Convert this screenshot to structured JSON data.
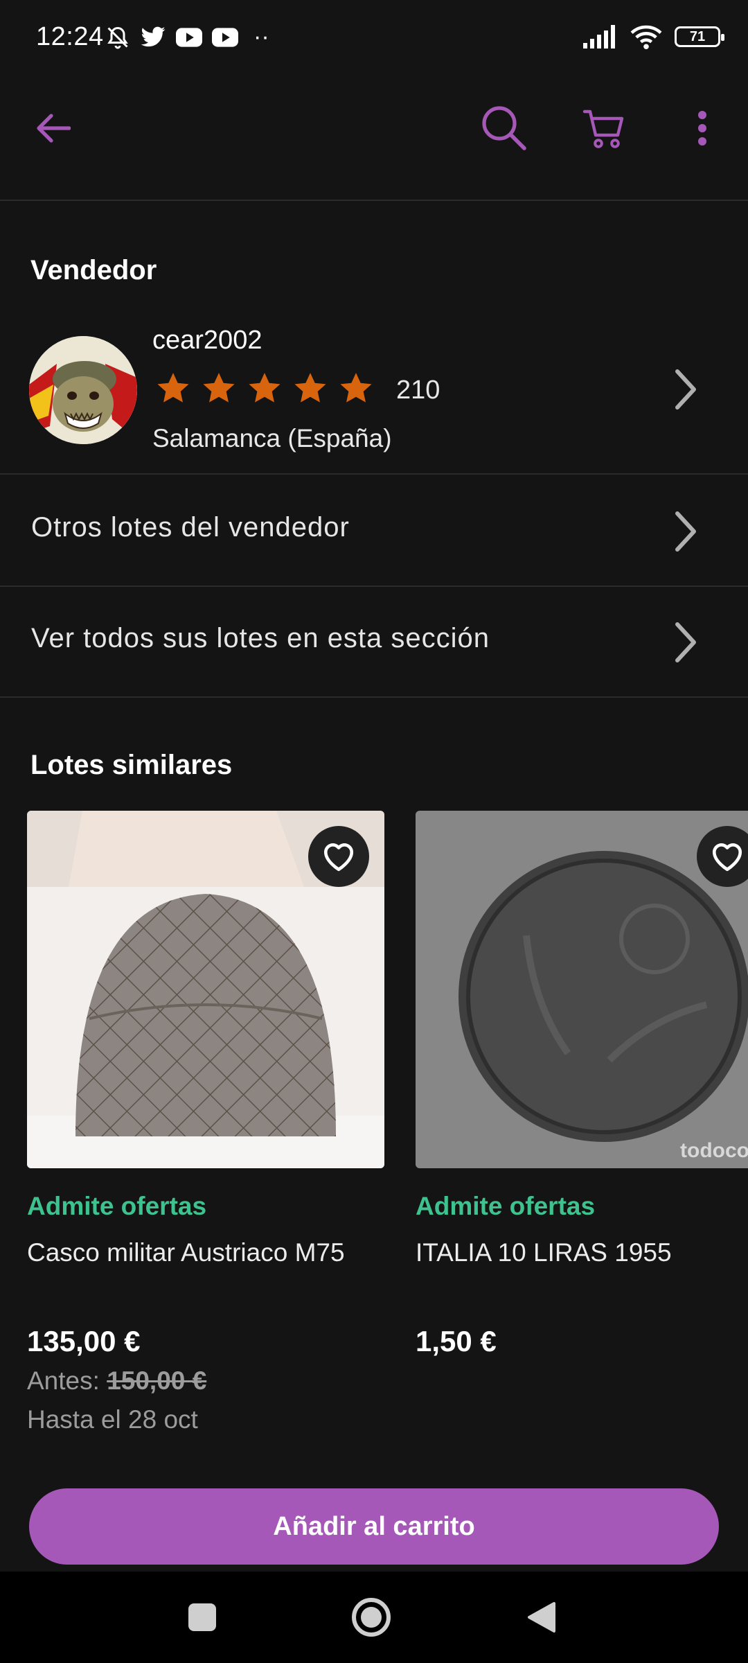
{
  "status_bar": {
    "time": "12:24",
    "battery": "71",
    "dots": "··"
  },
  "app_bar": {
    "accent": "#a658b8"
  },
  "seller_section": {
    "title": "Vendedor",
    "name": "cear2002",
    "rating_stars": 5,
    "rating_count": "210",
    "location": "Salamanca (España)"
  },
  "links": {
    "other_lots": "Otros lotes del vendedor",
    "all_in_section": "Ver todos sus lotes en esta sección"
  },
  "similar": {
    "title": "Lotes similares",
    "items": [
      {
        "offer": "Admite ofertas",
        "title": "Casco militar Austriaco M75",
        "price": "135,00 €",
        "before_label": "Antes:",
        "before_price": "150,00 €",
        "until": "Hasta el 28 oct"
      },
      {
        "offer": "Admite ofertas",
        "title": "ITALIA 10 LIRAS 1955",
        "price": "1,50 €",
        "watermark": "todoco"
      }
    ]
  },
  "cta": {
    "label": "Añadir al carrito"
  },
  "colors": {
    "background": "#141414",
    "accent": "#a658b8",
    "offer_green": "#3ec28f",
    "star_orange": "#d8640e"
  }
}
